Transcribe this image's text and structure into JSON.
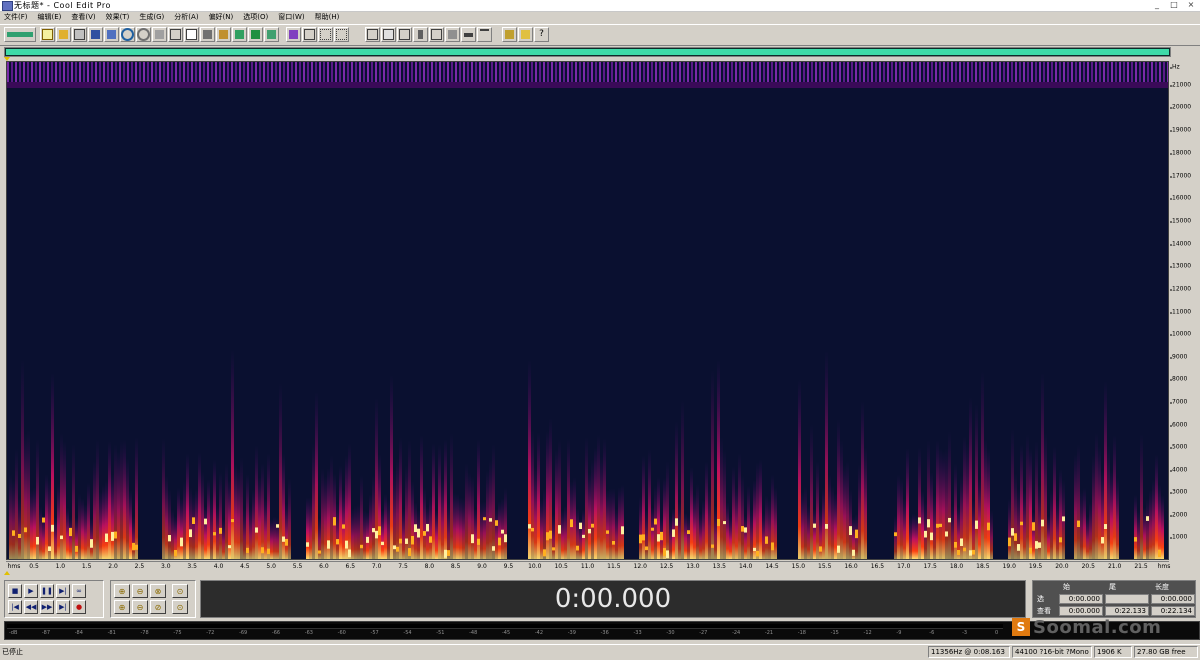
{
  "window": {
    "title": "无标题* - Cool Edit Pro",
    "min": "_",
    "max": "□",
    "close": "×"
  },
  "menu": [
    "文件(F)",
    "编辑(E)",
    "查看(V)",
    "效果(T)",
    "生成(G)",
    "分析(A)",
    "偏好(N)",
    "选项(O)",
    "窗口(W)",
    "帮助(H)"
  ],
  "spectrogram": {
    "hz_unit": "Hz",
    "hz_ticks": [
      "21000",
      "20000",
      "19000",
      "18000",
      "17000",
      "16000",
      "15000",
      "14000",
      "13000",
      "12000",
      "11000",
      "10000",
      "9000",
      "8000",
      "7000",
      "6000",
      "5000",
      "4000",
      "3000",
      "2000",
      "1000"
    ],
    "time_start": "hms",
    "time_end": "hms",
    "time_ticks": [
      "0.5",
      "1.0",
      "1.5",
      "2.0",
      "2.5",
      "3.0",
      "3.5",
      "4.0",
      "4.5",
      "5.0",
      "5.5",
      "6.0",
      "6.5",
      "7.0",
      "7.5",
      "8.0",
      "8.5",
      "9.0",
      "9.5",
      "10.0",
      "10.5",
      "11.0",
      "11.5",
      "12.0",
      "12.5",
      "13.0",
      "13.5",
      "14.0",
      "14.5",
      "15.0",
      "15.5",
      "16.0",
      "16.5",
      "17.0",
      "17.5",
      "18.0",
      "18.5",
      "19.0",
      "19.5",
      "20.0",
      "20.5",
      "21.0",
      "21.5"
    ],
    "colors": {
      "background": "#0a1030",
      "hot": "#ffd000",
      "mid": "#ff3010",
      "cool": "#8a1aa8"
    }
  },
  "transport": {
    "buttons": [
      "stop",
      "play",
      "pause",
      "play-to-end",
      "loop",
      "go-to-start",
      "rewind",
      "fast-forward",
      "go-to-end",
      "record"
    ]
  },
  "zoom": {
    "buttons": [
      "zoom-in-horizontal",
      "zoom-out-horizontal",
      "zoom-full",
      "zoom-selection",
      "zoom-in-vertical",
      "zoom-out-vertical",
      "zoom-left",
      "zoom-right"
    ]
  },
  "time_display": "0:00.000",
  "selection": {
    "headers": [
      "始",
      "尾",
      "长度"
    ],
    "rows": [
      {
        "label": "选",
        "begin": "0:00.000",
        "end": "",
        "length": "0:00.000"
      },
      {
        "label": "查看",
        "begin": "0:00.000",
        "end": "0:22.133",
        "length": "0:22.134"
      }
    ]
  },
  "level_meter": {
    "labels": [
      "-dB",
      "-87",
      "-84",
      "-81",
      "-78",
      "-75",
      "-72",
      "-69",
      "-66",
      "-63",
      "-60",
      "-57",
      "-54",
      "-51",
      "-48",
      "-45",
      "-42",
      "-39",
      "-36",
      "-33",
      "-30",
      "-27",
      "-24",
      "-21",
      "-18",
      "-15",
      "-12",
      "-9",
      "-6",
      "-3",
      "0"
    ]
  },
  "watermark": {
    "logo": "S",
    "text": "Soomal.com"
  },
  "status": {
    "left": "已停止",
    "cells": [
      "11356Hz @ 0:08.163",
      "44100 ?16-bit ?Mono",
      "1906 K",
      "27.80 GB free"
    ]
  }
}
